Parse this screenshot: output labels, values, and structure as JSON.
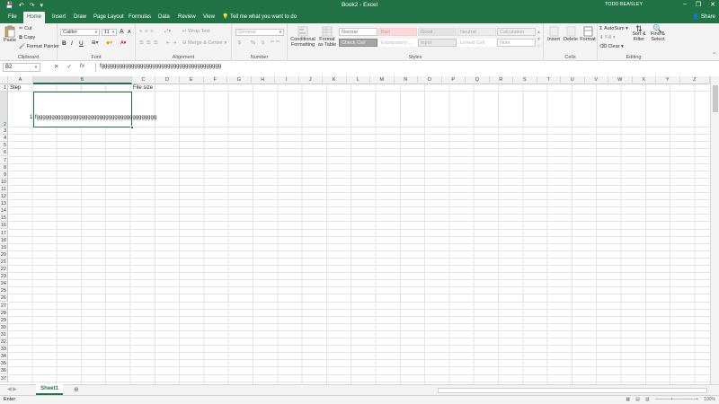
{
  "titlebar": {
    "title": "Book2 - Excel",
    "user": "TODD BEASLEY",
    "qat_save": "💾",
    "qat_undo": "↶",
    "qat_redo": "↷",
    "qat_more": "▾",
    "min": "–",
    "restore": "❐",
    "close": "✕"
  },
  "tabs": {
    "file": "File",
    "home": "Home",
    "insert": "Insert",
    "draw": "Draw",
    "page_layout": "Page Layout",
    "formulas": "Formulas",
    "data": "Data",
    "review": "Review",
    "view": "View",
    "tell_me": "Tell me what you want to do",
    "share": "Share"
  },
  "ribbon": {
    "clipboard": {
      "label": "Clipboard",
      "paste": "Paste",
      "cut": "Cut",
      "copy": "Copy",
      "format_painter": "Format Painter"
    },
    "font": {
      "label": "Font",
      "name": "Calibri",
      "size": "11",
      "grow": "A",
      "shrink": "A",
      "bold": "B",
      "italic": "I",
      "underline": "U"
    },
    "alignment": {
      "label": "Alignment",
      "wrap_text": "Wrap Text",
      "merge_center": "Merge & Center"
    },
    "number": {
      "label": "Number",
      "format": "General",
      "currency": "$",
      "percent": "%",
      "comma": "9"
    },
    "styles": {
      "label": "Styles",
      "conditional": "Conditional Formatting",
      "format_as_table": "Format as Table",
      "normal": "Normal",
      "bad": "Bad",
      "good": "Good",
      "neutral": "Neutral",
      "calculation": "Calculation",
      "check_cell": "Check Cell",
      "explanatory": "Explanatory ...",
      "input": "Input",
      "linked_cell": "Linked Cell",
      "note": "Note"
    },
    "cells": {
      "label": "Cells",
      "insert": "Insert",
      "delete": "Delete",
      "format": "Format"
    },
    "editing": {
      "label": "Editing",
      "autosum": "AutoSum",
      "fill": "Fill",
      "clear": "Clear",
      "sort_filter": "Sort & Filter",
      "find_select": "Find & Select"
    }
  },
  "formula_bar": {
    "name_box": "B2",
    "cancel": "✕",
    "enter": "✓",
    "fx": "fx",
    "content": "fgggggggggggggggggggggggggggggggggggggggg"
  },
  "grid": {
    "columns": [
      "A",
      "B",
      "C",
      "D",
      "E",
      "F",
      "G",
      "H",
      "I",
      "J",
      "K",
      "L",
      "M",
      "N",
      "O",
      "P",
      "Q",
      "R",
      "S",
      "T",
      "U",
      "V",
      "W",
      "X",
      "Y",
      "Z"
    ],
    "rows": [
      "1",
      "2",
      "3",
      "4",
      "5",
      "6",
      "7",
      "8",
      "9",
      "10",
      "11",
      "12",
      "13",
      "14",
      "15",
      "16",
      "17",
      "18",
      "19",
      "20",
      "21",
      "22",
      "23",
      "24",
      "25",
      "26",
      "27",
      "28",
      "29",
      "30",
      "31",
      "32",
      "33",
      "34",
      "35",
      "36",
      "37"
    ],
    "a1": "Step",
    "c1": "File size",
    "a2": "1",
    "b2": "fgggggggggggggggggggggggggggggggggggggggg"
  },
  "sheet": {
    "tab": "Sheet1",
    "add": "⊕"
  },
  "status": {
    "mode": "Enter",
    "zoom": "100%"
  },
  "colors": {
    "accent": "#217346",
    "ribbon_bg": "#f3f3f3"
  }
}
